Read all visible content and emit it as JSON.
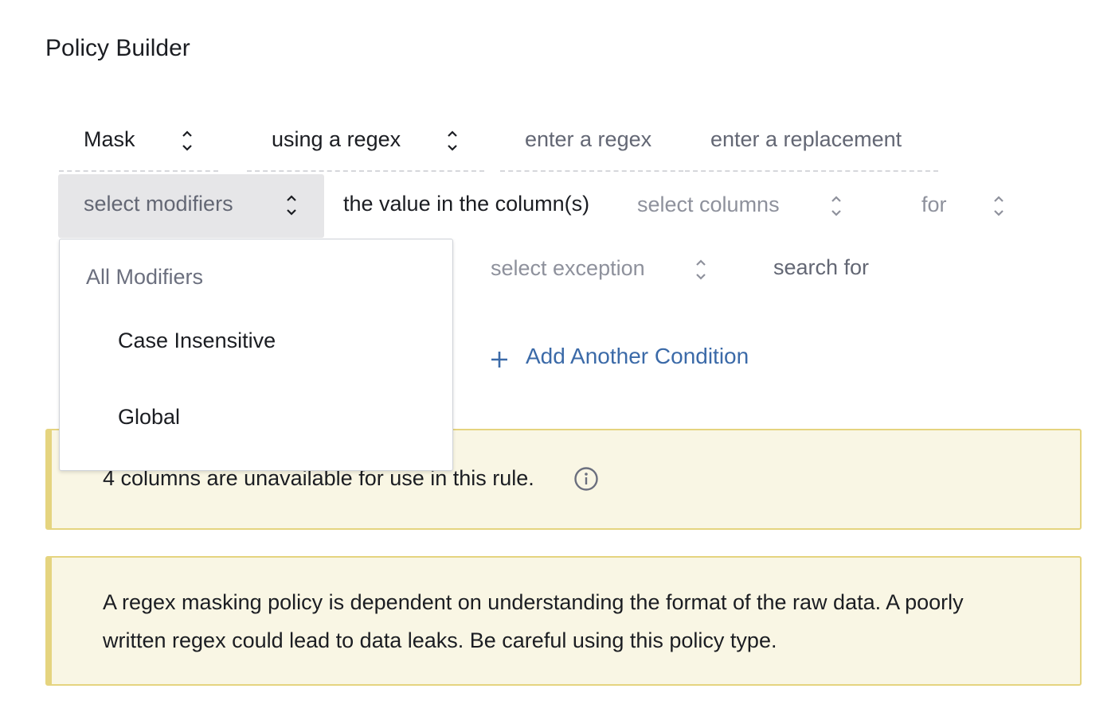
{
  "page": {
    "title": "Policy Builder"
  },
  "rule_row1": {
    "action_value": "Mask",
    "method_value": "using a regex",
    "regex_placeholder": "enter a regex",
    "replacement_placeholder": "enter a replacement"
  },
  "rule_row2": {
    "modifiers_placeholder": "select modifiers",
    "columns_label": "the value in the column(s)",
    "columns_placeholder": "select columns",
    "for_placeholder": "for"
  },
  "rule_row3": {
    "exception_placeholder": "select exception",
    "search_for_label": "search for"
  },
  "add_condition": {
    "label": "Add Another Condition",
    "icon": "plus-icon"
  },
  "modifiers_dropdown": {
    "group_label": "All Modifiers",
    "options": [
      "Case Insensitive",
      "Global"
    ]
  },
  "notices": [
    {
      "text": "4 columns are unavailable for use in this rule.",
      "icon": "info-icon"
    },
    {
      "line1": "A regex masking policy is dependent on understanding the format of the raw data. A poorly",
      "line2": "written regex could lead to data leaks. Be careful using this policy type."
    }
  ],
  "colors": {
    "notice_bg": "#f9f6e4",
    "notice_border": "#e5d47f",
    "link": "#3b6aa8",
    "select_active_bg": "#e6e6e8"
  }
}
